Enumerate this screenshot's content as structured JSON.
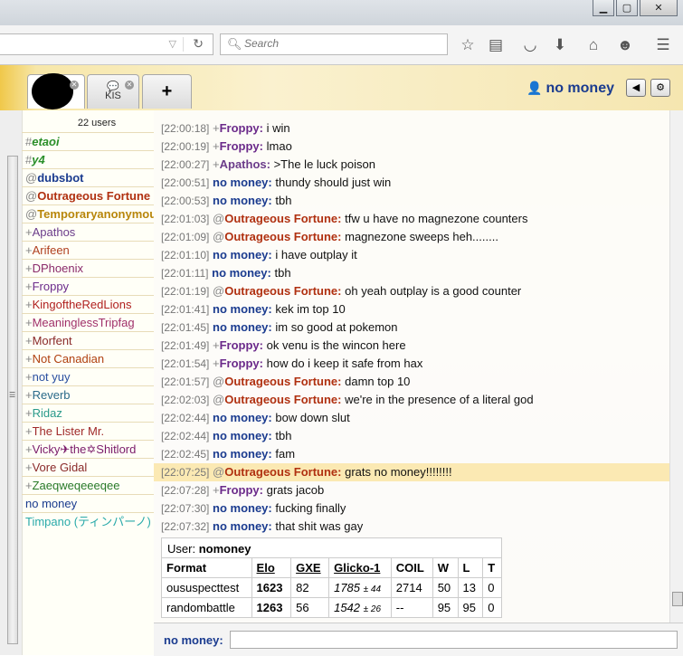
{
  "browser": {
    "search_placeholder": "Search",
    "window_min": "▁",
    "window_max": "▢",
    "window_close": "✕",
    "icons": [
      "star-icon",
      "reader-icon",
      "pocket-icon",
      "download-icon",
      "home-icon",
      "smiley-icon",
      "menu-icon"
    ]
  },
  "tabs": {
    "kis_label": "KIS",
    "kis_icon": "💬",
    "plus_label": "+"
  },
  "header": {
    "username": "no money",
    "user_icon": "👤",
    "sound_icon": "◀",
    "settings_icon": "⚙"
  },
  "userlist": {
    "count": "22 users",
    "users": [
      {
        "rank": "#",
        "name": "etaoi",
        "color": "#2a8f2a",
        "style": "bi"
      },
      {
        "rank": "#",
        "name": "y4",
        "color": "#2a8f2a",
        "style": "bi"
      },
      {
        "rank": "@",
        "name": "dubsbot",
        "color": "#1a3b8f",
        "style": "b"
      },
      {
        "rank": "@",
        "name": "Outrageous Fortune",
        "color": "#b03010",
        "style": "b"
      },
      {
        "rank": "@",
        "name": "Temporaryanonymous",
        "color": "#b8860b",
        "style": "b"
      },
      {
        "rank": "+",
        "name": "Apathos",
        "color": "#6b3c8a",
        "style": ""
      },
      {
        "rank": "+",
        "name": "Arifeen",
        "color": "#b04020",
        "style": ""
      },
      {
        "rank": "+",
        "name": "DPhoenix",
        "color": "#8a2a6a",
        "style": ""
      },
      {
        "rank": "+",
        "name": "Froppy",
        "color": "#6b2a8a",
        "style": ""
      },
      {
        "rank": "+",
        "name": "KingoftheRedLions",
        "color": "#b02020",
        "style": ""
      },
      {
        "rank": "+",
        "name": "MeaninglessTripfag",
        "color": "#a0306a",
        "style": ""
      },
      {
        "rank": "+",
        "name": "Morfent",
        "color": "#8a2a2a",
        "style": ""
      },
      {
        "rank": "+",
        "name": "Not Canadian",
        "color": "#b04010",
        "style": ""
      },
      {
        "rank": "+",
        "name": "not yuy",
        "color": "#2a4fa0",
        "style": ""
      },
      {
        "rank": "+",
        "name": "Reverb",
        "color": "#2a6a8a",
        "style": ""
      },
      {
        "rank": "+",
        "name": "Ridaz",
        "color": "#2a9a8a",
        "style": ""
      },
      {
        "rank": "+",
        "name": "The Lister Mr.",
        "color": "#a02a2a",
        "style": ""
      },
      {
        "rank": "+",
        "name": "Vicky✈the✡Shitlord",
        "color": "#7a1a6a",
        "style": ""
      },
      {
        "rank": "+",
        "name": "Vore Gidal",
        "color": "#8a2a2a",
        "style": ""
      },
      {
        "rank": "+",
        "name": "Zaeqweqeeeqee",
        "color": "#2a7a2a",
        "style": ""
      },
      {
        "rank": " ",
        "name": "no money",
        "color": "#1a3b8f",
        "style": ""
      },
      {
        "rank": " ",
        "name": "Timpano (ティンパーノ)",
        "color": "#2aaaaa",
        "style": ""
      }
    ]
  },
  "chat": {
    "messages": [
      {
        "ts": "[22:00:18]",
        "rank": "+",
        "name": "Froppy:",
        "color": "#6b2a8a",
        "text": "i win",
        "hl": false
      },
      {
        "ts": "[22:00:19]",
        "rank": "+",
        "name": "Froppy:",
        "color": "#6b2a8a",
        "text": "lmao",
        "hl": false
      },
      {
        "ts": "[22:00:27]",
        "rank": "+",
        "name": "Apathos:",
        "color": "#6b3c8a",
        "text": ">The le luck poison",
        "hl": false
      },
      {
        "ts": "[22:00:51]",
        "rank": "",
        "name": "no money:",
        "color": "#1a3b8f",
        "text": "thundy should just win",
        "hl": false
      },
      {
        "ts": "[22:00:53]",
        "rank": "",
        "name": "no money:",
        "color": "#1a3b8f",
        "text": "tbh",
        "hl": false
      },
      {
        "ts": "[22:01:03]",
        "rank": "@",
        "name": "Outrageous Fortune:",
        "color": "#b03010",
        "text": "tfw u have no magnezone counters",
        "hl": false
      },
      {
        "ts": "[22:01:09]",
        "rank": "@",
        "name": "Outrageous Fortune:",
        "color": "#b03010",
        "text": "magnezone sweeps heh........",
        "hl": false
      },
      {
        "ts": "[22:01:10]",
        "rank": "",
        "name": "no money:",
        "color": "#1a3b8f",
        "text": "i have outplay it",
        "hl": false
      },
      {
        "ts": "[22:01:11]",
        "rank": "",
        "name": "no money:",
        "color": "#1a3b8f",
        "text": "tbh",
        "hl": false
      },
      {
        "ts": "[22:01:19]",
        "rank": "@",
        "name": "Outrageous Fortune:",
        "color": "#b03010",
        "text": "oh yeah outplay is a good counter",
        "hl": false
      },
      {
        "ts": "[22:01:41]",
        "rank": "",
        "name": "no money:",
        "color": "#1a3b8f",
        "text": "kek im top 10",
        "hl": false
      },
      {
        "ts": "[22:01:45]",
        "rank": "",
        "name": "no money:",
        "color": "#1a3b8f",
        "text": "im so good at pokemon",
        "hl": false
      },
      {
        "ts": "[22:01:49]",
        "rank": "+",
        "name": "Froppy:",
        "color": "#6b2a8a",
        "text": "ok venu is the wincon here",
        "hl": false
      },
      {
        "ts": "[22:01:54]",
        "rank": "+",
        "name": "Froppy:",
        "color": "#6b2a8a",
        "text": "how do i keep it safe from hax",
        "hl": false
      },
      {
        "ts": "[22:01:57]",
        "rank": "@",
        "name": "Outrageous Fortune:",
        "color": "#b03010",
        "text": "damn top 10",
        "hl": false
      },
      {
        "ts": "[22:02:03]",
        "rank": "@",
        "name": "Outrageous Fortune:",
        "color": "#b03010",
        "text": "we're in the presence of a literal god",
        "hl": false
      },
      {
        "ts": "[22:02:44]",
        "rank": "",
        "name": "no money:",
        "color": "#1a3b8f",
        "text": "bow down slut",
        "hl": false
      },
      {
        "ts": "[22:02:44]",
        "rank": "",
        "name": "no money:",
        "color": "#1a3b8f",
        "text": "tbh",
        "hl": false
      },
      {
        "ts": "[22:02:45]",
        "rank": "",
        "name": "no money:",
        "color": "#1a3b8f",
        "text": "fam",
        "hl": false
      },
      {
        "ts": "[22:07:25]",
        "rank": "@",
        "name": "Outrageous Fortune:",
        "color": "#b03010",
        "text": "grats no money!!!!!!!!",
        "hl": true
      },
      {
        "ts": "[22:07:28]",
        "rank": "+",
        "name": "Froppy:",
        "color": "#6b2a8a",
        "text": "grats jacob",
        "hl": false
      },
      {
        "ts": "[22:07:30]",
        "rank": "",
        "name": "no money:",
        "color": "#1a3b8f",
        "text": "fucking finally",
        "hl": false
      },
      {
        "ts": "[22:07:32]",
        "rank": "",
        "name": "no money:",
        "color": "#1a3b8f",
        "text": "that shit was gaу",
        "hl": false
      }
    ]
  },
  "stats": {
    "user_label": "User:",
    "user_name": "nomoney",
    "headers": [
      "Format",
      "Elo",
      "GXE",
      "Glicko-1",
      "COIL",
      "W",
      "L",
      "T"
    ],
    "rows": [
      {
        "format": "oususpecttest",
        "elo": "1623",
        "gxe": "82",
        "glicko": "1785",
        "glicko_dev": "± 44",
        "coil": "2714",
        "w": "50",
        "l": "13",
        "t": "0"
      },
      {
        "format": "randombattle",
        "elo": "1263",
        "gxe": "56",
        "glicko": "1542",
        "glicko_dev": "± 26",
        "coil": "--",
        "w": "95",
        "l": "95",
        "t": "0"
      }
    ]
  },
  "composer": {
    "label": "no money:",
    "value": ""
  }
}
